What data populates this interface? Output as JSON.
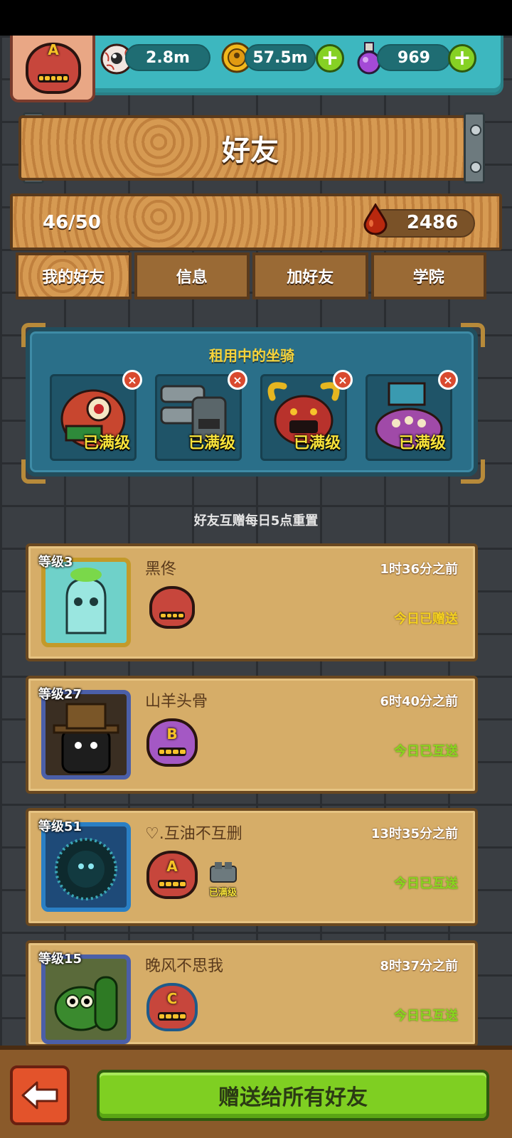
{
  "currency": {
    "eyes": "2.8m",
    "coins": "57.5m",
    "potions": "969",
    "add_symbol": "+"
  },
  "profile": {
    "badge_letter": "A"
  },
  "header": {
    "title": "好友"
  },
  "stats": {
    "friend_count": "46/50",
    "blood": "2486"
  },
  "tabs": [
    {
      "label": "我的好友",
      "active": true
    },
    {
      "label": "信息",
      "active": false
    },
    {
      "label": "加好友",
      "active": false
    },
    {
      "label": "学院",
      "active": false
    }
  ],
  "rental": {
    "title": "租用中的坐骑",
    "close_symbol": "×",
    "mounts": [
      {
        "status": "已满级",
        "color": "#c8462f"
      },
      {
        "status": "已满级",
        "color": "#6d7a7e"
      },
      {
        "status": "已满级",
        "color": "#b8322c"
      },
      {
        "status": "已满级",
        "color": "#a04aa8"
      }
    ]
  },
  "reset_note": "好友互赠每日5点重置",
  "friends": [
    {
      "level": "等级3",
      "name": "黑佟",
      "time": "1时36分之前",
      "status": "今日已赠送",
      "status_color": "#f5d21f",
      "badge_letter": "",
      "avatar_bg": "#6fd1c9",
      "frame": "#c39a2a",
      "extra": ""
    },
    {
      "level": "等级27",
      "name": "山羊头骨",
      "time": "6时40分之前",
      "status": "今日已互送",
      "status_color": "#8ad61f",
      "badge_letter": "B",
      "avatar_bg": "#2a2a2a",
      "frame": "#4b5fa8",
      "extra": ""
    },
    {
      "level": "等级51",
      "name": "♡.互油不互删",
      "time": "13时35分之前",
      "status": "今日已互送",
      "status_color": "#8ad61f",
      "badge_letter": "A",
      "avatar_bg": "#1e4a78",
      "frame": "#2a7fc4",
      "extra": "已满级"
    },
    {
      "level": "等级15",
      "name": "晚风不思我",
      "time": "8时37分之前",
      "status": "今日已互送",
      "status_color": "#8ad61f",
      "badge_letter": "C",
      "avatar_bg": "#5a6a3a",
      "frame": "#4b5fa8",
      "extra": ""
    }
  ],
  "footer": {
    "send_all": "赠送给所有好友"
  }
}
